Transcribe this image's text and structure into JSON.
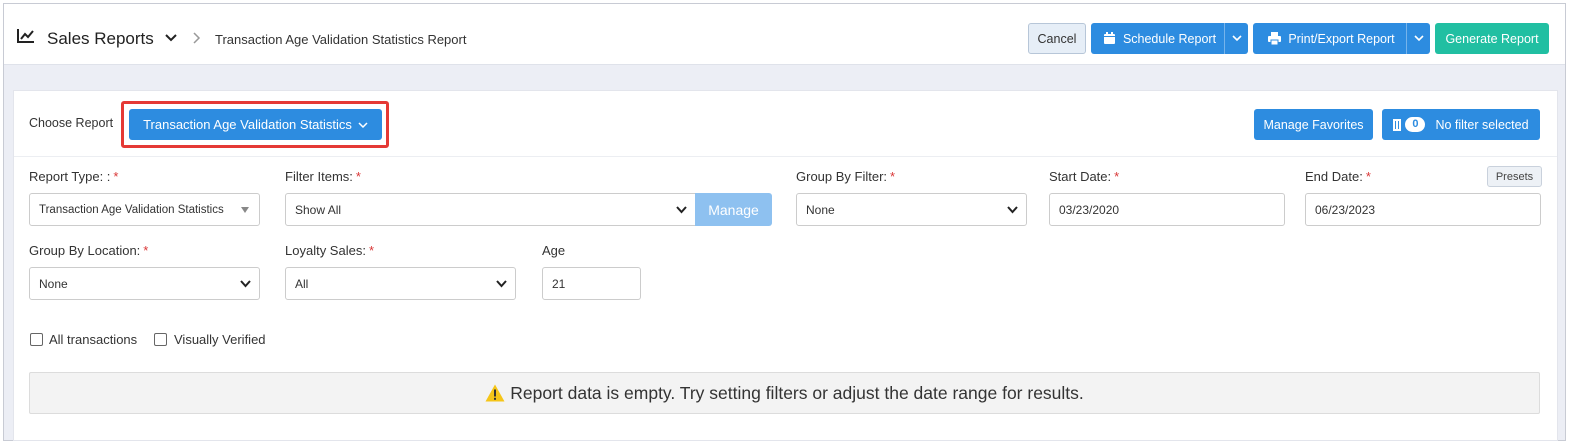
{
  "header": {
    "title": "Sales Reports",
    "breadcrumb": "Transaction Age Validation Statistics Report",
    "buttons": {
      "cancel": "Cancel",
      "schedule": "Schedule Report",
      "print": "Print/Export Report",
      "generate": "Generate Report"
    }
  },
  "chooser": {
    "label": "Choose Report",
    "selected": "Transaction Age Validation Statistics",
    "manage_favorites": "Manage Favorites",
    "filter_count": "0",
    "filter_status": "No filter selected"
  },
  "filters": {
    "report_type": {
      "label": "Report Type: :",
      "value": "Transaction Age Validation Statistics"
    },
    "filter_items": {
      "label": "Filter Items:",
      "value": "Show All",
      "manage": "Manage"
    },
    "group_by_filter": {
      "label": "Group By Filter:",
      "value": "None"
    },
    "start_date": {
      "label": "Start Date:",
      "value": "03/23/2020"
    },
    "end_date": {
      "label": "End Date:",
      "value": "06/23/2023",
      "presets": "Presets"
    },
    "group_by_location": {
      "label": "Group By Location:",
      "value": "None"
    },
    "loyalty_sales": {
      "label": "Loyalty Sales:",
      "value": "All"
    },
    "age": {
      "label": "Age",
      "value": "21"
    },
    "required_mark": "*"
  },
  "options": {
    "all_transactions": {
      "label": "All transactions",
      "checked": false
    },
    "visually_verified": {
      "label": "Visually Verified",
      "checked": false
    }
  },
  "message": "Report data is empty. Try setting filters or adjust the date range for results.",
  "colors": {
    "primary": "#2d8ce0",
    "success": "#21bfa2",
    "highlight": "#e53935",
    "warning": "#f5c518"
  }
}
